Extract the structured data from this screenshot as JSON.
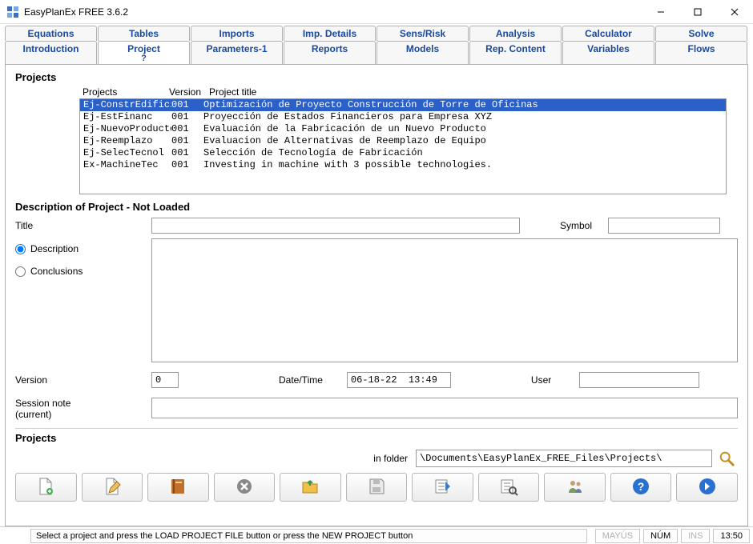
{
  "window": {
    "title": "EasyPlanEx FREE  3.6.2"
  },
  "tabs_row1": [
    "Equations",
    "Tables",
    "Imports",
    "Imp. Details",
    "Sens/Risk",
    "Analysis",
    "Calculator",
    "Solve"
  ],
  "tabs_row2": [
    "Introduction",
    "Project",
    "Parameters-1",
    "Reports",
    "Models",
    "Rep. Content",
    "Variables",
    "Flows"
  ],
  "active_tab": "Project",
  "active_tab_sub": "?",
  "projects": {
    "section_title": "Projects",
    "headers": {
      "c1": "Projects",
      "c2": "Version",
      "c3": "Project title"
    },
    "rows": [
      {
        "name": "Ej-ConstrEdificio",
        "version": "001",
        "title": "Optimización de Proyecto Construcción de Torre de Oficinas"
      },
      {
        "name": "Ej-EstFinanc",
        "version": "001",
        "title": "Proyección de Estados Financieros para Empresa XYZ"
      },
      {
        "name": "Ej-NuevoProducto",
        "version": "001",
        "title": "Evaluación de la Fabricación de un Nuevo Producto"
      },
      {
        "name": "Ej-Reemplazo",
        "version": "001",
        "title": "Evaluacion de Alternativas de Reemplazo de Equipo"
      },
      {
        "name": "Ej-SelecTecnol",
        "version": "001",
        "title": "Selección de Tecnología de Fabricación"
      },
      {
        "name": "Ex-MachineTec",
        "version": "001",
        "title": "Investing in machine with 3 possible technologies."
      }
    ],
    "selected_index": 0
  },
  "description": {
    "header": "Description of Project - Not Loaded",
    "labels": {
      "title": "Title",
      "symbol": "Symbol",
      "description": "Description",
      "conclusions": "Conclusions",
      "version": "Version",
      "datetime": "Date/Time",
      "user": "User",
      "session_note": "Session note",
      "session_current": "(current)"
    },
    "values": {
      "title": "",
      "symbol": "",
      "body": "",
      "version": "0",
      "datetime": "06-18-22  13:49",
      "user": "",
      "session_note": ""
    },
    "radio_selected": "description"
  },
  "folder": {
    "section_title": "Projects",
    "label": "in  folder",
    "path": "\\Documents\\EasyPlanEx_FREE_Files\\Projects\\"
  },
  "toolbar_icons": [
    "new-document-icon",
    "edit-document-icon",
    "book-icon",
    "cancel-icon",
    "open-folder-icon",
    "save-icon",
    "export-spreadsheet-icon",
    "find-spreadsheet-icon",
    "users-icon",
    "help-icon",
    "next-arrow-icon"
  ],
  "statusbar": {
    "message": "Select a project and press the LOAD PROJECT FILE button or press the NEW PROJECT button",
    "mayus": "MAYÚS",
    "num": "NÚM",
    "ins": "INS",
    "time": "13:50"
  }
}
